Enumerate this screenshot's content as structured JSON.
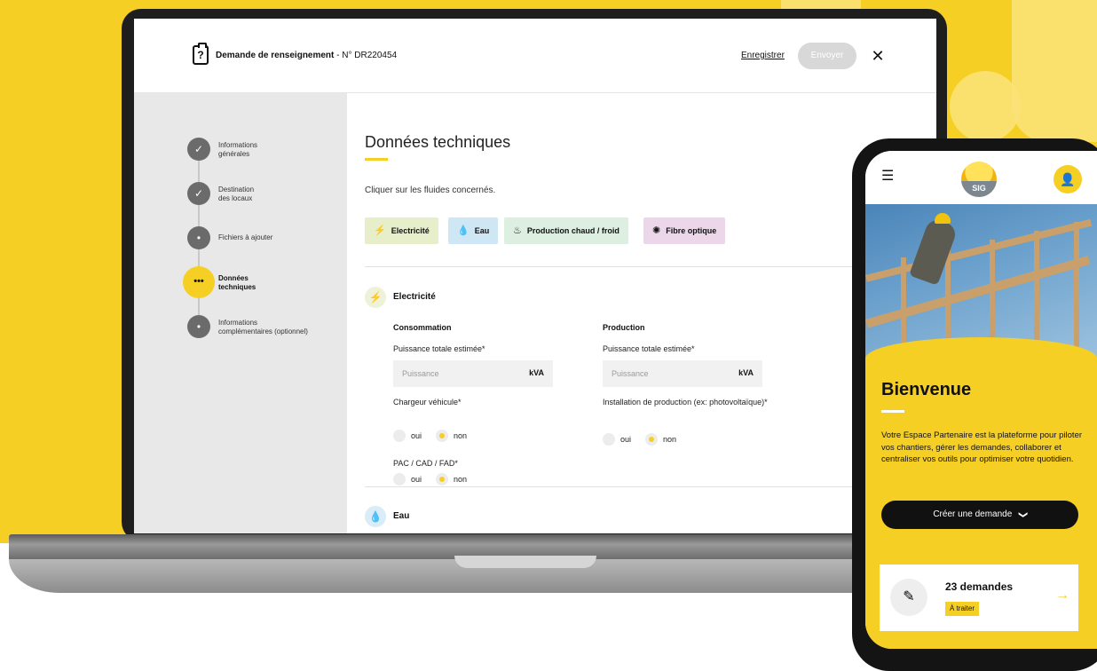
{
  "laptop": {
    "header": {
      "form_title": "Demande de renseignement",
      "form_number": " - N° DR220454",
      "save_label": "Enregistrer",
      "send_label": "Envoyer",
      "close_glyph": "✕",
      "clipboard_glyph": "?"
    },
    "steps": [
      {
        "label": "Informations\ngénérales",
        "state": "done",
        "glyph": "✓"
      },
      {
        "label": "Destination\ndes locaux",
        "state": "done",
        "glyph": "✓"
      },
      {
        "label": "Fichiers à ajouter",
        "state": "pending",
        "glyph": "•"
      },
      {
        "label": "Données\ntechniques",
        "state": "active",
        "glyph": "•••"
      },
      {
        "label": "Informations\ncomplémentaires (optionnel)",
        "state": "pending",
        "glyph": "•"
      }
    ],
    "main": {
      "title": "Données techniques",
      "instruction": "Cliquer sur les fluides concernés.",
      "fluids": [
        {
          "label": "Electricité",
          "icon": "plug-icon",
          "glyph": "⚡",
          "color": "#e6efc9"
        },
        {
          "label": "Eau",
          "icon": "drop-icon",
          "glyph": "💧",
          "color": "#cfe7f5"
        },
        {
          "label": "Production chaud / froid",
          "icon": "heat-icon",
          "glyph": "♨",
          "color": "#dcefe0"
        },
        {
          "label": "Fibre optique",
          "icon": "fiber-icon",
          "glyph": "✺",
          "color": "#ecd7ea"
        }
      ],
      "electricity": {
        "title": "Electricité",
        "glyph": "⚡",
        "consumption": {
          "heading": "Consommation",
          "power_label": "Puissance totale estimée*",
          "power_placeholder": "Puissance",
          "power_unit": "kVA",
          "charger_label": "Chargeur véhicule*",
          "charger_yes": "oui",
          "charger_no": "non",
          "pac_label": "PAC / CAD / FAD*",
          "pac_yes": "oui",
          "pac_no": "non"
        },
        "production": {
          "heading": "Production",
          "power_label": "Puissance totale estimée*",
          "power_placeholder": "Puissance",
          "power_unit": "kVA",
          "install_label": "Installation de production (ex: photovoltaïque)*",
          "install_yes": "oui",
          "install_no": "non"
        }
      },
      "water": {
        "title": "Eau",
        "glyph": "💧"
      }
    }
  },
  "phone": {
    "menu_glyph": "☰",
    "logo_text": "SIG",
    "avatar_glyph": "👤",
    "welcome_title": "Bienvenue",
    "welcome_text": "Votre Espace Partenaire est la plateforme pour piloter vos chantiers, gérer les demandes, collaborer et centraliser vos outils pour optimiser votre quotidien.",
    "create_label": "Créer une demande",
    "create_chevron": "❯",
    "card_icon_glyph": "✎",
    "card_title": "23 demandes",
    "card_badge": "À traiter",
    "card_arrow": "→"
  },
  "colors": {
    "brand_yellow": "#f6cf24",
    "dark": "#111111"
  }
}
